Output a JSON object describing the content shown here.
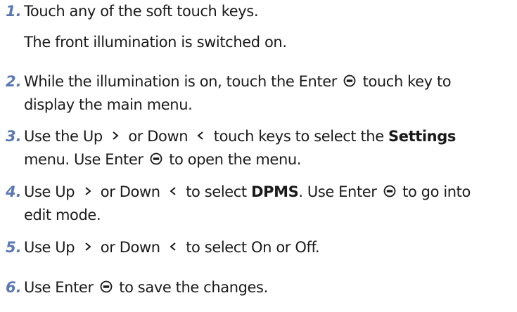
{
  "steps": [
    {
      "number": "1.",
      "text": "Touch any of the soft touch keys.",
      "result": "The front illumination is switched on."
    },
    {
      "number": "2.",
      "line1_a": "While the illumination is on, touch the Enter",
      "line1_b": "touch key to",
      "line2": "display the main menu."
    },
    {
      "number": "3.",
      "line1_a": "Use the Up",
      "line1_b": "or Down",
      "line1_c": "touch keys to select the",
      "line1_bold": "Settings",
      "line2_a": "menu. Use Enter",
      "line2_b": "to open the menu."
    },
    {
      "number": "4.",
      "line1_a": "Use Up",
      "line1_b": "or Down",
      "line1_c": "to select",
      "line1_bold": "DPMS",
      "line1_d": ". Use Enter",
      "line1_e": "to go into",
      "line2": "edit mode."
    },
    {
      "number": "5.",
      "line1_a": "Use Up",
      "line1_b": "or Down",
      "line1_c": "to select On or Off."
    },
    {
      "number": "6.",
      "line1_a": "Use Enter",
      "line1_b": "to save the changes."
    }
  ],
  "icons": {
    "enter": "enter-key-icon",
    "up": "chevron-right-icon",
    "down": "chevron-left-icon"
  },
  "colors": {
    "step_number": "#5a78b4",
    "text": "#1a1a1a"
  }
}
